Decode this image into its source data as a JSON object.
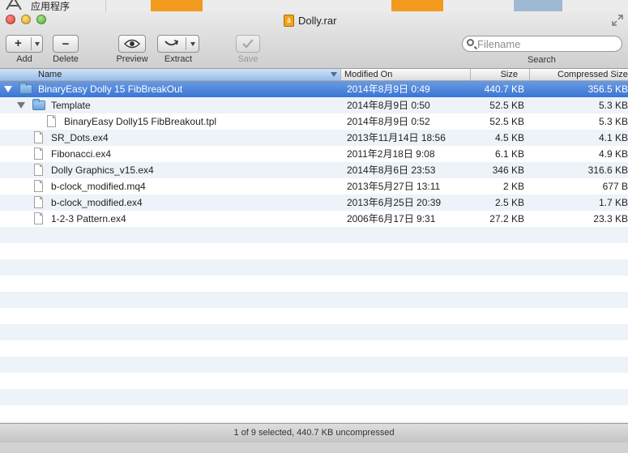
{
  "background": {
    "app_label": "应用程序"
  },
  "window": {
    "title": "Dolly.rar"
  },
  "toolbar": {
    "add_label": "Add",
    "add_glyph": "+",
    "delete_label": "Delete",
    "delete_glyph": "−",
    "preview_label": "Preview",
    "extract_label": "Extract",
    "save_label": "Save",
    "search_placeholder": "Filename",
    "search_label": "Search"
  },
  "columns": {
    "name": "Name",
    "modified": "Modified On",
    "size": "Size",
    "compressed": "Compressed Size"
  },
  "rows": [
    {
      "name": "BinaryEasy Dolly 15 FibBreakOut",
      "modified": "2014年8月9日 0:49",
      "size": "440.7 KB",
      "compressed": "356.5 KB",
      "kind": "folder",
      "level": 0,
      "expanded": true,
      "selected": true
    },
    {
      "name": "Template",
      "modified": "2014年8月9日 0:50",
      "size": "52.5 KB",
      "compressed": "5.3 KB",
      "kind": "folder",
      "level": 1,
      "expanded": true,
      "selected": false
    },
    {
      "name": "BinaryEasy Dolly15 FibBreakout.tpl",
      "modified": "2014年8月9日 0:52",
      "size": "52.5 KB",
      "compressed": "5.3 KB",
      "kind": "file",
      "level": 2,
      "selected": false
    },
    {
      "name": "SR_Dots.ex4",
      "modified": "2013年11月14日 18:56",
      "size": "4.5 KB",
      "compressed": "4.1 KB",
      "kind": "file",
      "level": 1,
      "selected": false
    },
    {
      "name": "Fibonacci.ex4",
      "modified": "2011年2月18日 9:08",
      "size": "6.1 KB",
      "compressed": "4.9 KB",
      "kind": "file",
      "level": 1,
      "selected": false
    },
    {
      "name": "Dolly Graphics_v15.ex4",
      "modified": "2014年8月6日 23:53",
      "size": "346 KB",
      "compressed": "316.6 KB",
      "kind": "file",
      "level": 1,
      "selected": false
    },
    {
      "name": "b-clock_modified.mq4",
      "modified": "2013年5月27日 13:11",
      "size": "2 KB",
      "compressed": "677 B",
      "kind": "file",
      "level": 1,
      "selected": false
    },
    {
      "name": "b-clock_modified.ex4",
      "modified": "2013年6月25日 20:39",
      "size": "2.5 KB",
      "compressed": "1.7 KB",
      "kind": "file",
      "level": 1,
      "selected": false
    },
    {
      "name": "1-2-3 Pattern.ex4",
      "modified": "2006年6月17日 9:31",
      "size": "27.2 KB",
      "compressed": "23.3 KB",
      "kind": "file",
      "level": 1,
      "selected": false
    }
  ],
  "status": {
    "text": "1 of 9 selected, 440.7 KB uncompressed"
  }
}
